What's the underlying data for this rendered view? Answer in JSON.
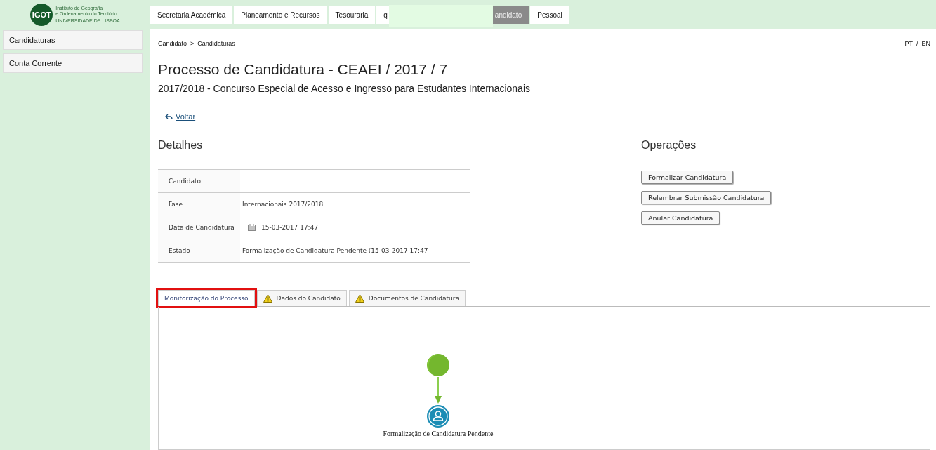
{
  "logo": {
    "badge": "IGOT",
    "line_1": "Instituto de Geografia",
    "line_2": "e Ordenamento do Território",
    "line_3": "UNIVERSIDADE DE LISBOA"
  },
  "top_nav": [
    {
      "label": "Secretaria Académica",
      "selected": false
    },
    {
      "label": "Planeamento e Recursos",
      "selected": false
    },
    {
      "label": "Tesouraria",
      "selected": false
    },
    {
      "label": "q",
      "selected": false
    },
    {
      "label": "andidato",
      "selected": true
    },
    {
      "label": "Pessoal",
      "selected": false
    }
  ],
  "sidebar": {
    "items": [
      {
        "label": "Candidaturas"
      },
      {
        "label": "Conta Corrente"
      }
    ]
  },
  "breadcrumb": [
    "Candidato",
    "Candidaturas"
  ],
  "breadcrumb_separator": ">",
  "languages": [
    "PT",
    "EN"
  ],
  "language_separator": "/",
  "title": "Processo de Candidatura - CEAEI / 2017 / 7",
  "subtitle": "2017/2018 - Concurso Especial de Acesso e Ingresso para Estudantes Internacionais",
  "back_link": "Voltar",
  "details": {
    "heading": "Detalhes",
    "rows": [
      {
        "label": "Candidato"
      },
      {
        "label": "Fase",
        "value": "Internacionais 2017/2018"
      },
      {
        "label": "Data de Candidatura",
        "value": "15-03-2017 17:47",
        "kind": "date"
      },
      {
        "label": "Estado",
        "value": "Formalização de Candidatura Pendente (15-03-2017 17:47 -"
      }
    ]
  },
  "operations": {
    "heading": "Operações",
    "buttons": [
      "Formalizar Candidatura",
      "Relembrar Submissão Candidatura",
      "Anular Candidatura"
    ]
  },
  "tabs": [
    {
      "label": "Monitorização do Processo",
      "selected": true,
      "warning": false,
      "highlighted": true
    },
    {
      "label": "Dados do Candidato",
      "selected": false,
      "warning": true,
      "highlighted": false
    },
    {
      "label": "Documentos de Candidatura",
      "selected": false,
      "warning": true,
      "highlighted": false
    }
  ],
  "process": {
    "task": "Formalização de Candidatura Pendente"
  }
}
